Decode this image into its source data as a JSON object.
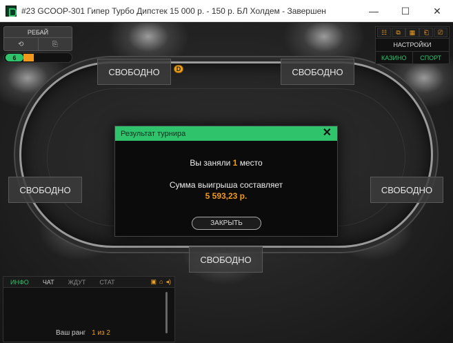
{
  "window": {
    "title": "#23 GCOOP-301 Гипер Турбо Дипстек 15 000 р. - 150 р. БЛ Холдем - Завершен",
    "controls": [
      "—",
      "☐",
      "✕"
    ]
  },
  "rebuy": {
    "label": "РЕБАЙ",
    "icon_left": "⟲",
    "icon_right": "⎘"
  },
  "level": {
    "value": "6",
    "progress": 0.15
  },
  "right_panel": {
    "icons": [
      "☷",
      "⧉",
      "▦",
      "⎗",
      "⎚"
    ],
    "settings_label": "НАСТРОЙКИ",
    "casino_label": "КАЗИНО",
    "sport_label": "СПОРТ"
  },
  "seats": {
    "top_left": "СВОБОДНО",
    "top_right": "СВОБОДНО",
    "left": "СВОБОДНО",
    "right": "СВОБОДНО",
    "bottom": "СВОБОДНО"
  },
  "dealer_button": "D",
  "dialog": {
    "title": "Результат турнира",
    "close": "✕",
    "line1_prefix": "Вы заняли",
    "place": "1",
    "line1_suffix": "место",
    "line2": "Сумма выигрыша составляет",
    "amount": "5 593,23 р.",
    "button": "ЗАКРЫТЬ"
  },
  "chat": {
    "tabs": [
      "ИНФО",
      "ЧАТ",
      "ЖДУТ",
      "СТАТ"
    ],
    "icons": [
      "▣",
      "⌂",
      "◂)"
    ],
    "rank_label": "Ваш ранг",
    "rank_value": "1 из 2"
  },
  "colors": {
    "accent_green": "#2fc36b",
    "accent_orange": "#f39a1b"
  }
}
